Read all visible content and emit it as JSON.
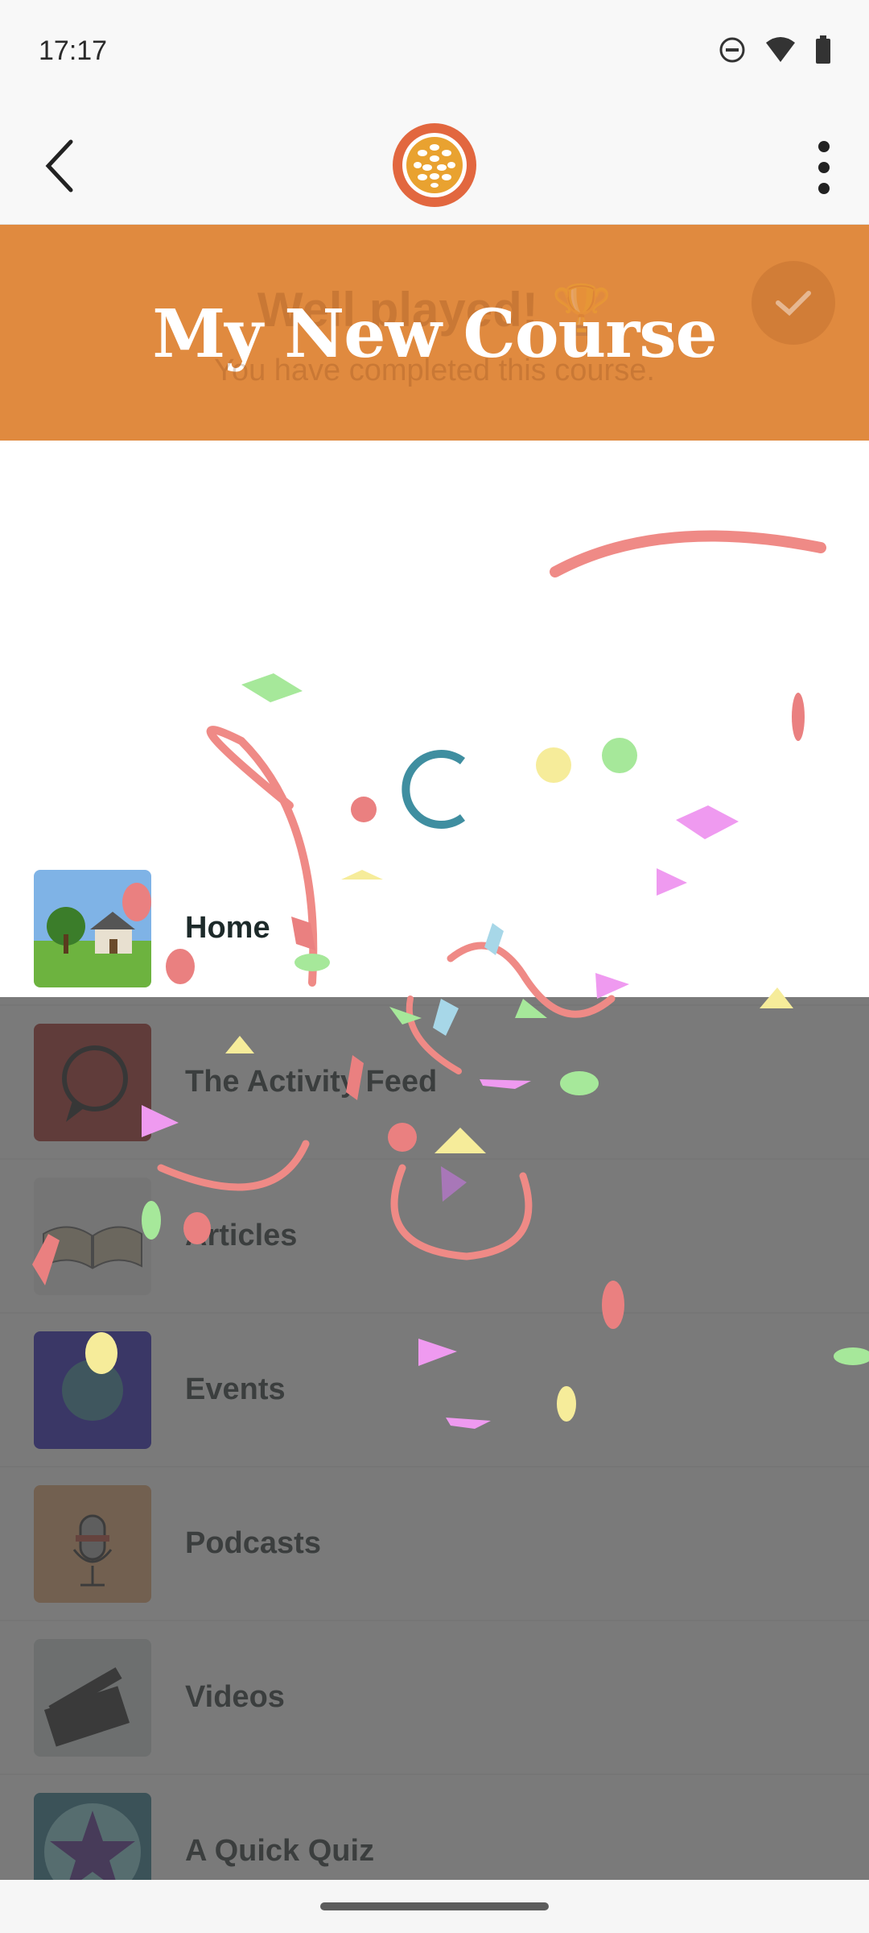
{
  "status_bar": {
    "time": "17:17"
  },
  "app_bar": {
    "logo": "orange-dots-logo"
  },
  "hero": {
    "title": "My New Course",
    "overlay_title": "Well played! 🏆",
    "overlay_subtitle": "You have completed this course."
  },
  "course_items": [
    {
      "label": "Home",
      "icon": "house-thumbnail"
    },
    {
      "label": "The Activity Feed",
      "icon": "speech-bubble-thumbnail"
    },
    {
      "label": "Articles",
      "icon": "open-book-thumbnail"
    },
    {
      "label": "Events",
      "icon": "events-thumbnail"
    },
    {
      "label": "Podcasts",
      "icon": "microphone-thumbnail"
    },
    {
      "label": "Videos",
      "icon": "clapperboard-thumbnail"
    },
    {
      "label": "A Quick Quiz",
      "icon": "star-thumbnail"
    }
  ],
  "colors": {
    "accent": "#e08a3f",
    "overlay": "#6a6a6a"
  }
}
